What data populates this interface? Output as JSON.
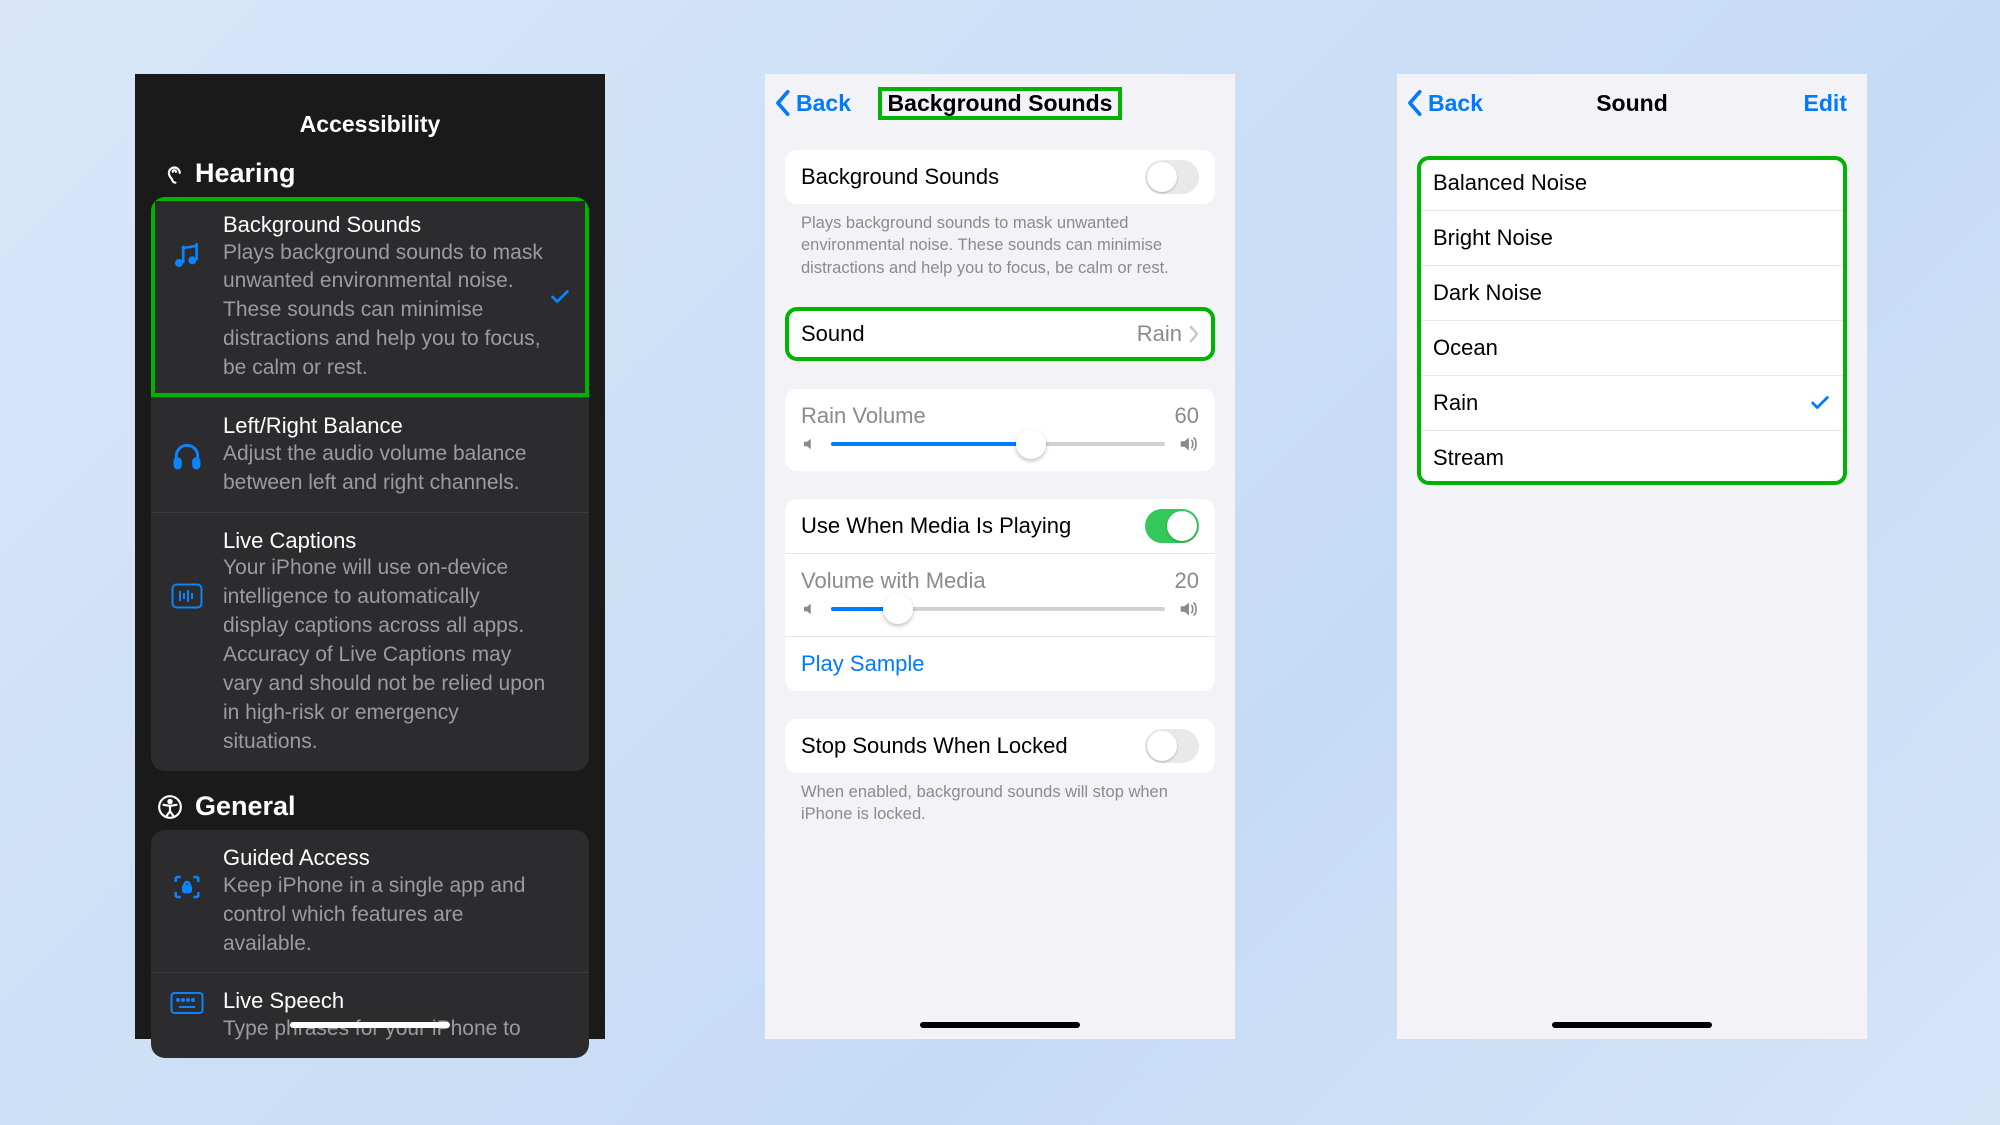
{
  "phone1": {
    "title": "Accessibility",
    "sectionHearing": "Hearing",
    "sectionGeneral": "General",
    "rows": {
      "bgSounds": {
        "title": "Background Sounds",
        "desc": "Plays background sounds to mask unwanted environmental noise. These sounds can minimise distractions and help you to focus, be calm or rest."
      },
      "balance": {
        "title": "Left/Right Balance",
        "desc": "Adjust the audio volume balance between left and right channels."
      },
      "liveCaptions": {
        "title": "Live Captions",
        "desc": "Your iPhone will use on-device intelligence to automatically display captions across all apps. Accuracy of Live Captions may vary and should not be relied upon in high-risk or emergency situations."
      },
      "guidedAccess": {
        "title": "Guided Access",
        "desc": "Keep iPhone in a single app and control which features are available."
      },
      "liveSpeech": {
        "title": "Live Speech",
        "desc": "Type phrases for your iPhone to"
      }
    }
  },
  "phone2": {
    "back": "Back",
    "title": "Background Sounds",
    "bgToggleLabel": "Background Sounds",
    "bgToggleOn": false,
    "bgDesc": "Plays background sounds to mask unwanted environmental noise. These sounds can minimise distractions and help you to focus, be calm or rest.",
    "soundLabel": "Sound",
    "soundValue": "Rain",
    "rainVolLabel": "Rain Volume",
    "rainVolValue": "60",
    "rainVolPct": 60,
    "useWhenMediaLabel": "Use When Media Is Playing",
    "useWhenMediaOn": true,
    "volWithMediaLabel": "Volume with Media",
    "volWithMediaValue": "20",
    "volWithMediaPct": 20,
    "playSample": "Play Sample",
    "stopWhenLockedLabel": "Stop Sounds When Locked",
    "stopWhenLockedOn": false,
    "stopWhenLockedDesc": "When enabled, background sounds will stop when iPhone is locked."
  },
  "phone3": {
    "back": "Back",
    "title": "Sound",
    "edit": "Edit",
    "selected": "Rain",
    "options": [
      "Balanced Noise",
      "Bright Noise",
      "Dark Noise",
      "Ocean",
      "Rain",
      "Stream"
    ]
  }
}
